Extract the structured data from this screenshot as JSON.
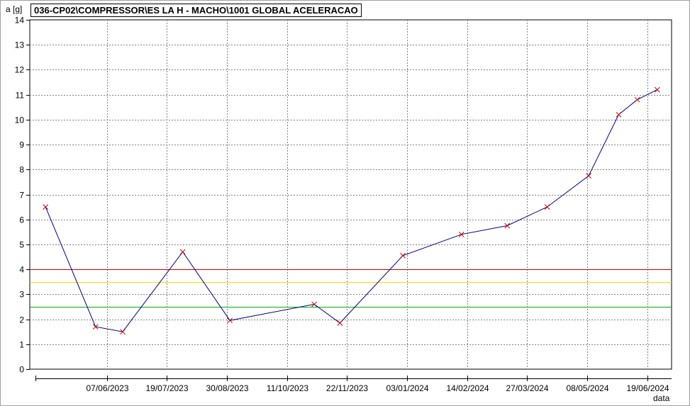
{
  "chart_data": {
    "type": "line",
    "title": "036-CP02\\COMPRESSOR\\ES LA H - MACHO\\1001 GLOBAL ACELERACAO",
    "ylabel": "a [g]",
    "xlabel": "data",
    "ylim": [
      0,
      14
    ],
    "yticks": [
      0,
      1,
      2,
      3,
      4,
      5,
      6,
      7,
      8,
      9,
      10,
      11,
      12,
      13,
      14
    ],
    "xlim": [
      "2023-04-14",
      "2024-07-06"
    ],
    "xticks": [
      "07/06/2023",
      "19/07/2023",
      "30/08/2023",
      "11/10/2023",
      "22/11/2023",
      "03/01/2024",
      "14/02/2024",
      "27/03/2024",
      "08/05/2024",
      "19/06/2024"
    ],
    "grid": true,
    "series": [
      {
        "color": "#00007f",
        "marker_color": "#c00000",
        "x": [
          "2023-04-25",
          "2023-05-30",
          "2023-06-18",
          "2023-07-30",
          "2023-09-01",
          "2023-10-30",
          "2023-11-17",
          "2023-12-31",
          "2024-02-10",
          "2024-03-13",
          "2024-04-10",
          "2024-05-09",
          "2024-05-30",
          "2024-06-12",
          "2024-06-26"
        ],
        "y": [
          6.5,
          1.7,
          1.5,
          4.7,
          1.95,
          2.6,
          1.85,
          4.55,
          5.4,
          5.75,
          6.5,
          7.75,
          10.2,
          10.8,
          11.2
        ]
      }
    ],
    "threshold_lines": [
      {
        "y": 4.0,
        "color": "#cc0000"
      },
      {
        "y": 3.5,
        "color": "#ffd700"
      },
      {
        "y": 2.5,
        "color": "#00b000"
      }
    ]
  }
}
